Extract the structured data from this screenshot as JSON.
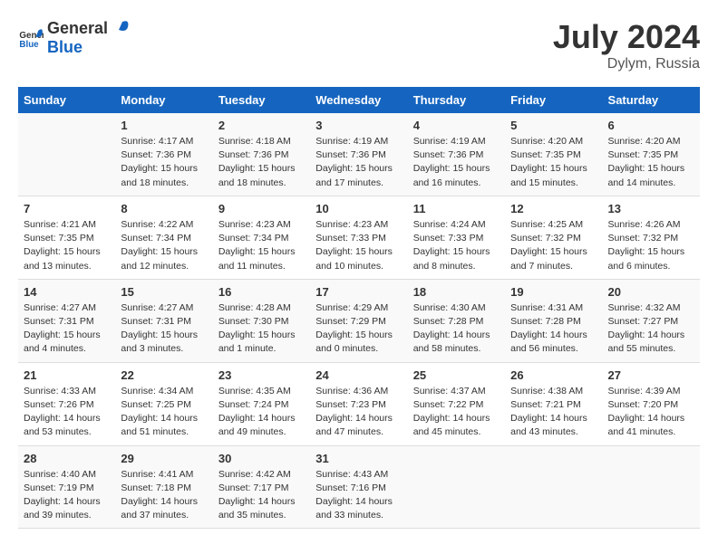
{
  "header": {
    "logo_general": "General",
    "logo_blue": "Blue",
    "month": "July 2024",
    "location": "Dylym, Russia"
  },
  "days_of_week": [
    "Sunday",
    "Monday",
    "Tuesday",
    "Wednesday",
    "Thursday",
    "Friday",
    "Saturday"
  ],
  "weeks": [
    [
      {
        "day": "",
        "sunrise": "",
        "sunset": "",
        "daylight": ""
      },
      {
        "day": "1",
        "sunrise": "Sunrise: 4:17 AM",
        "sunset": "Sunset: 7:36 PM",
        "daylight": "Daylight: 15 hours and 18 minutes."
      },
      {
        "day": "2",
        "sunrise": "Sunrise: 4:18 AM",
        "sunset": "Sunset: 7:36 PM",
        "daylight": "Daylight: 15 hours and 18 minutes."
      },
      {
        "day": "3",
        "sunrise": "Sunrise: 4:19 AM",
        "sunset": "Sunset: 7:36 PM",
        "daylight": "Daylight: 15 hours and 17 minutes."
      },
      {
        "day": "4",
        "sunrise": "Sunrise: 4:19 AM",
        "sunset": "Sunset: 7:36 PM",
        "daylight": "Daylight: 15 hours and 16 minutes."
      },
      {
        "day": "5",
        "sunrise": "Sunrise: 4:20 AM",
        "sunset": "Sunset: 7:35 PM",
        "daylight": "Daylight: 15 hours and 15 minutes."
      },
      {
        "day": "6",
        "sunrise": "Sunrise: 4:20 AM",
        "sunset": "Sunset: 7:35 PM",
        "daylight": "Daylight: 15 hours and 14 minutes."
      }
    ],
    [
      {
        "day": "7",
        "sunrise": "Sunrise: 4:21 AM",
        "sunset": "Sunset: 7:35 PM",
        "daylight": "Daylight: 15 hours and 13 minutes."
      },
      {
        "day": "8",
        "sunrise": "Sunrise: 4:22 AM",
        "sunset": "Sunset: 7:34 PM",
        "daylight": "Daylight: 15 hours and 12 minutes."
      },
      {
        "day": "9",
        "sunrise": "Sunrise: 4:23 AM",
        "sunset": "Sunset: 7:34 PM",
        "daylight": "Daylight: 15 hours and 11 minutes."
      },
      {
        "day": "10",
        "sunrise": "Sunrise: 4:23 AM",
        "sunset": "Sunset: 7:33 PM",
        "daylight": "Daylight: 15 hours and 10 minutes."
      },
      {
        "day": "11",
        "sunrise": "Sunrise: 4:24 AM",
        "sunset": "Sunset: 7:33 PM",
        "daylight": "Daylight: 15 hours and 8 minutes."
      },
      {
        "day": "12",
        "sunrise": "Sunrise: 4:25 AM",
        "sunset": "Sunset: 7:32 PM",
        "daylight": "Daylight: 15 hours and 7 minutes."
      },
      {
        "day": "13",
        "sunrise": "Sunrise: 4:26 AM",
        "sunset": "Sunset: 7:32 PM",
        "daylight": "Daylight: 15 hours and 6 minutes."
      }
    ],
    [
      {
        "day": "14",
        "sunrise": "Sunrise: 4:27 AM",
        "sunset": "Sunset: 7:31 PM",
        "daylight": "Daylight: 15 hours and 4 minutes."
      },
      {
        "day": "15",
        "sunrise": "Sunrise: 4:27 AM",
        "sunset": "Sunset: 7:31 PM",
        "daylight": "Daylight: 15 hours and 3 minutes."
      },
      {
        "day": "16",
        "sunrise": "Sunrise: 4:28 AM",
        "sunset": "Sunset: 7:30 PM",
        "daylight": "Daylight: 15 hours and 1 minute."
      },
      {
        "day": "17",
        "sunrise": "Sunrise: 4:29 AM",
        "sunset": "Sunset: 7:29 PM",
        "daylight": "Daylight: 15 hours and 0 minutes."
      },
      {
        "day": "18",
        "sunrise": "Sunrise: 4:30 AM",
        "sunset": "Sunset: 7:28 PM",
        "daylight": "Daylight: 14 hours and 58 minutes."
      },
      {
        "day": "19",
        "sunrise": "Sunrise: 4:31 AM",
        "sunset": "Sunset: 7:28 PM",
        "daylight": "Daylight: 14 hours and 56 minutes."
      },
      {
        "day": "20",
        "sunrise": "Sunrise: 4:32 AM",
        "sunset": "Sunset: 7:27 PM",
        "daylight": "Daylight: 14 hours and 55 minutes."
      }
    ],
    [
      {
        "day": "21",
        "sunrise": "Sunrise: 4:33 AM",
        "sunset": "Sunset: 7:26 PM",
        "daylight": "Daylight: 14 hours and 53 minutes."
      },
      {
        "day": "22",
        "sunrise": "Sunrise: 4:34 AM",
        "sunset": "Sunset: 7:25 PM",
        "daylight": "Daylight: 14 hours and 51 minutes."
      },
      {
        "day": "23",
        "sunrise": "Sunrise: 4:35 AM",
        "sunset": "Sunset: 7:24 PM",
        "daylight": "Daylight: 14 hours and 49 minutes."
      },
      {
        "day": "24",
        "sunrise": "Sunrise: 4:36 AM",
        "sunset": "Sunset: 7:23 PM",
        "daylight": "Daylight: 14 hours and 47 minutes."
      },
      {
        "day": "25",
        "sunrise": "Sunrise: 4:37 AM",
        "sunset": "Sunset: 7:22 PM",
        "daylight": "Daylight: 14 hours and 45 minutes."
      },
      {
        "day": "26",
        "sunrise": "Sunrise: 4:38 AM",
        "sunset": "Sunset: 7:21 PM",
        "daylight": "Daylight: 14 hours and 43 minutes."
      },
      {
        "day": "27",
        "sunrise": "Sunrise: 4:39 AM",
        "sunset": "Sunset: 7:20 PM",
        "daylight": "Daylight: 14 hours and 41 minutes."
      }
    ],
    [
      {
        "day": "28",
        "sunrise": "Sunrise: 4:40 AM",
        "sunset": "Sunset: 7:19 PM",
        "daylight": "Daylight: 14 hours and 39 minutes."
      },
      {
        "day": "29",
        "sunrise": "Sunrise: 4:41 AM",
        "sunset": "Sunset: 7:18 PM",
        "daylight": "Daylight: 14 hours and 37 minutes."
      },
      {
        "day": "30",
        "sunrise": "Sunrise: 4:42 AM",
        "sunset": "Sunset: 7:17 PM",
        "daylight": "Daylight: 14 hours and 35 minutes."
      },
      {
        "day": "31",
        "sunrise": "Sunrise: 4:43 AM",
        "sunset": "Sunset: 7:16 PM",
        "daylight": "Daylight: 14 hours and 33 minutes."
      },
      {
        "day": "",
        "sunrise": "",
        "sunset": "",
        "daylight": ""
      },
      {
        "day": "",
        "sunrise": "",
        "sunset": "",
        "daylight": ""
      },
      {
        "day": "",
        "sunrise": "",
        "sunset": "",
        "daylight": ""
      }
    ]
  ]
}
